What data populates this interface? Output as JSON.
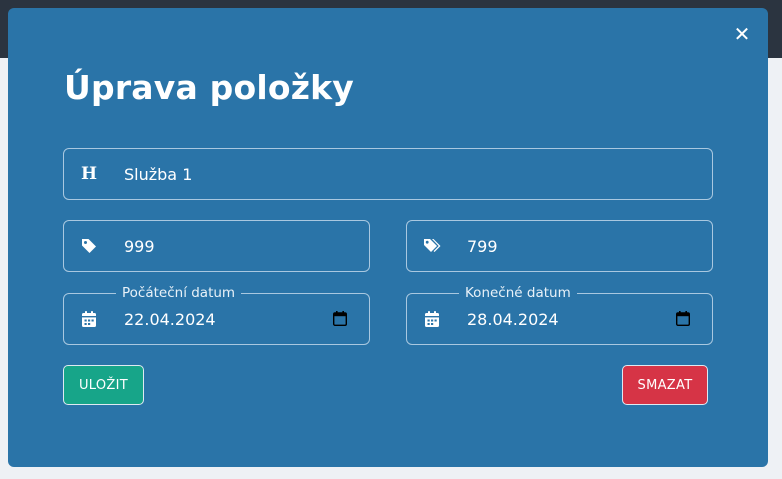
{
  "modal": {
    "title": "Úprava položky",
    "close_icon": "close-icon",
    "name_field": {
      "icon": "heading-icon",
      "value": "Služba 1"
    },
    "price_field": {
      "icon": "tag-icon",
      "value": "999"
    },
    "sale_price_field": {
      "icon": "tags-icon",
      "value": "799"
    },
    "start_date": {
      "label": "Počáteční datum",
      "icon": "calendar-icon",
      "value": "22.04.2024"
    },
    "end_date": {
      "label": "Konečné datum",
      "icon": "calendar-icon",
      "value": "28.04.2024"
    },
    "save_label": "ULOŽIT",
    "delete_label": "SMAZAT"
  },
  "colors": {
    "modal_bg": "#2a74a8",
    "topbar": "#2b3440",
    "save": "#17a589",
    "delete": "#d63446",
    "field_border": "#a9c8e0"
  }
}
